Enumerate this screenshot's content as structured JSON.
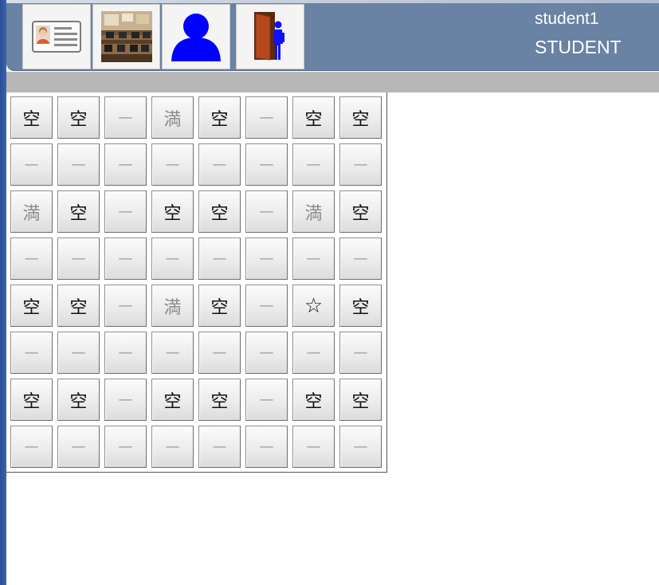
{
  "toolbar": {
    "buttons": [
      {
        "name": "profile-card-button",
        "icon": "id-card-icon"
      },
      {
        "name": "classroom-button",
        "icon": "classroom-photo-icon"
      },
      {
        "name": "user-button",
        "icon": "user-silhouette-icon"
      },
      {
        "name": "logout-button",
        "icon": "exit-door-icon"
      }
    ]
  },
  "user": {
    "name": "student1",
    "role": "STUDENT"
  },
  "seat_grid": {
    "rows": [
      [
        "空",
        "空",
        "—",
        "満",
        "空",
        "—",
        "空",
        "空"
      ],
      [
        "—",
        "—",
        "—",
        "—",
        "—",
        "—",
        "—",
        "—"
      ],
      [
        "満",
        "空",
        "—",
        "空",
        "空",
        "—",
        "満",
        "空"
      ],
      [
        "—",
        "—",
        "—",
        "—",
        "—",
        "—",
        "—",
        "—"
      ],
      [
        "空",
        "空",
        "—",
        "満",
        "空",
        "—",
        "☆",
        "空"
      ],
      [
        "—",
        "—",
        "—",
        "—",
        "—",
        "—",
        "—",
        "—"
      ],
      [
        "空",
        "空",
        "—",
        "空",
        "空",
        "—",
        "空",
        "空"
      ],
      [
        "—",
        "—",
        "—",
        "—",
        "—",
        "—",
        "—",
        "—"
      ]
    ]
  },
  "colors": {
    "header_bg": "#6a82a3",
    "gray_strip": "#b7b7b7",
    "full_text": "#8c8c8c",
    "empty_text": "#111111",
    "user_icon_blue": "#0000ff"
  }
}
